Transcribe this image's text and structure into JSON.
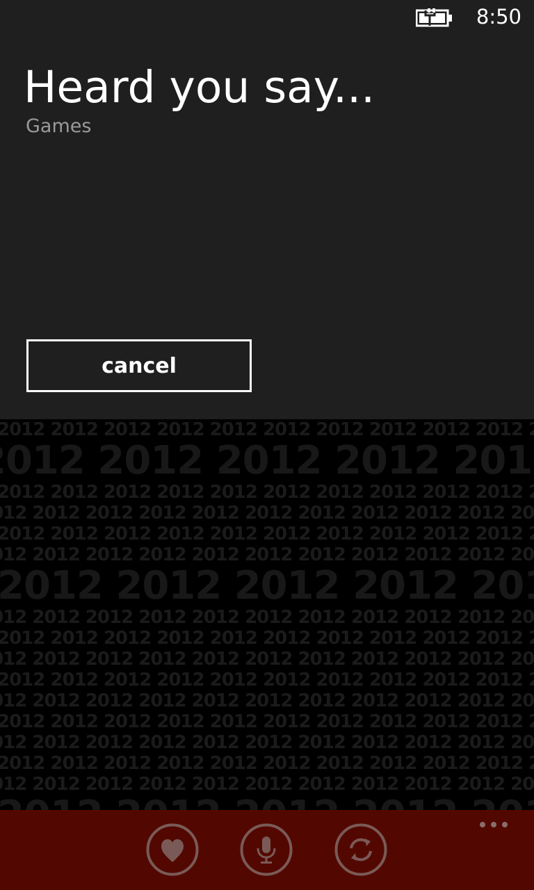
{
  "status_bar": {
    "time": "8:50",
    "battery_icon": "battery-charging-icon"
  },
  "dialog": {
    "title": "Heard you say...",
    "heard_text": "Games",
    "cancel_label": "cancel"
  },
  "background": {
    "pattern_text": "2012"
  },
  "app_bar": {
    "buttons": [
      {
        "icon": "heart-icon"
      },
      {
        "icon": "microphone-icon"
      },
      {
        "icon": "sync-icon"
      }
    ],
    "more_icon": "more-dots-icon"
  },
  "colors": {
    "dialog_background": "#1f1f1f",
    "app_bar": "#520800",
    "subtle_text": "#9a9a9a"
  }
}
